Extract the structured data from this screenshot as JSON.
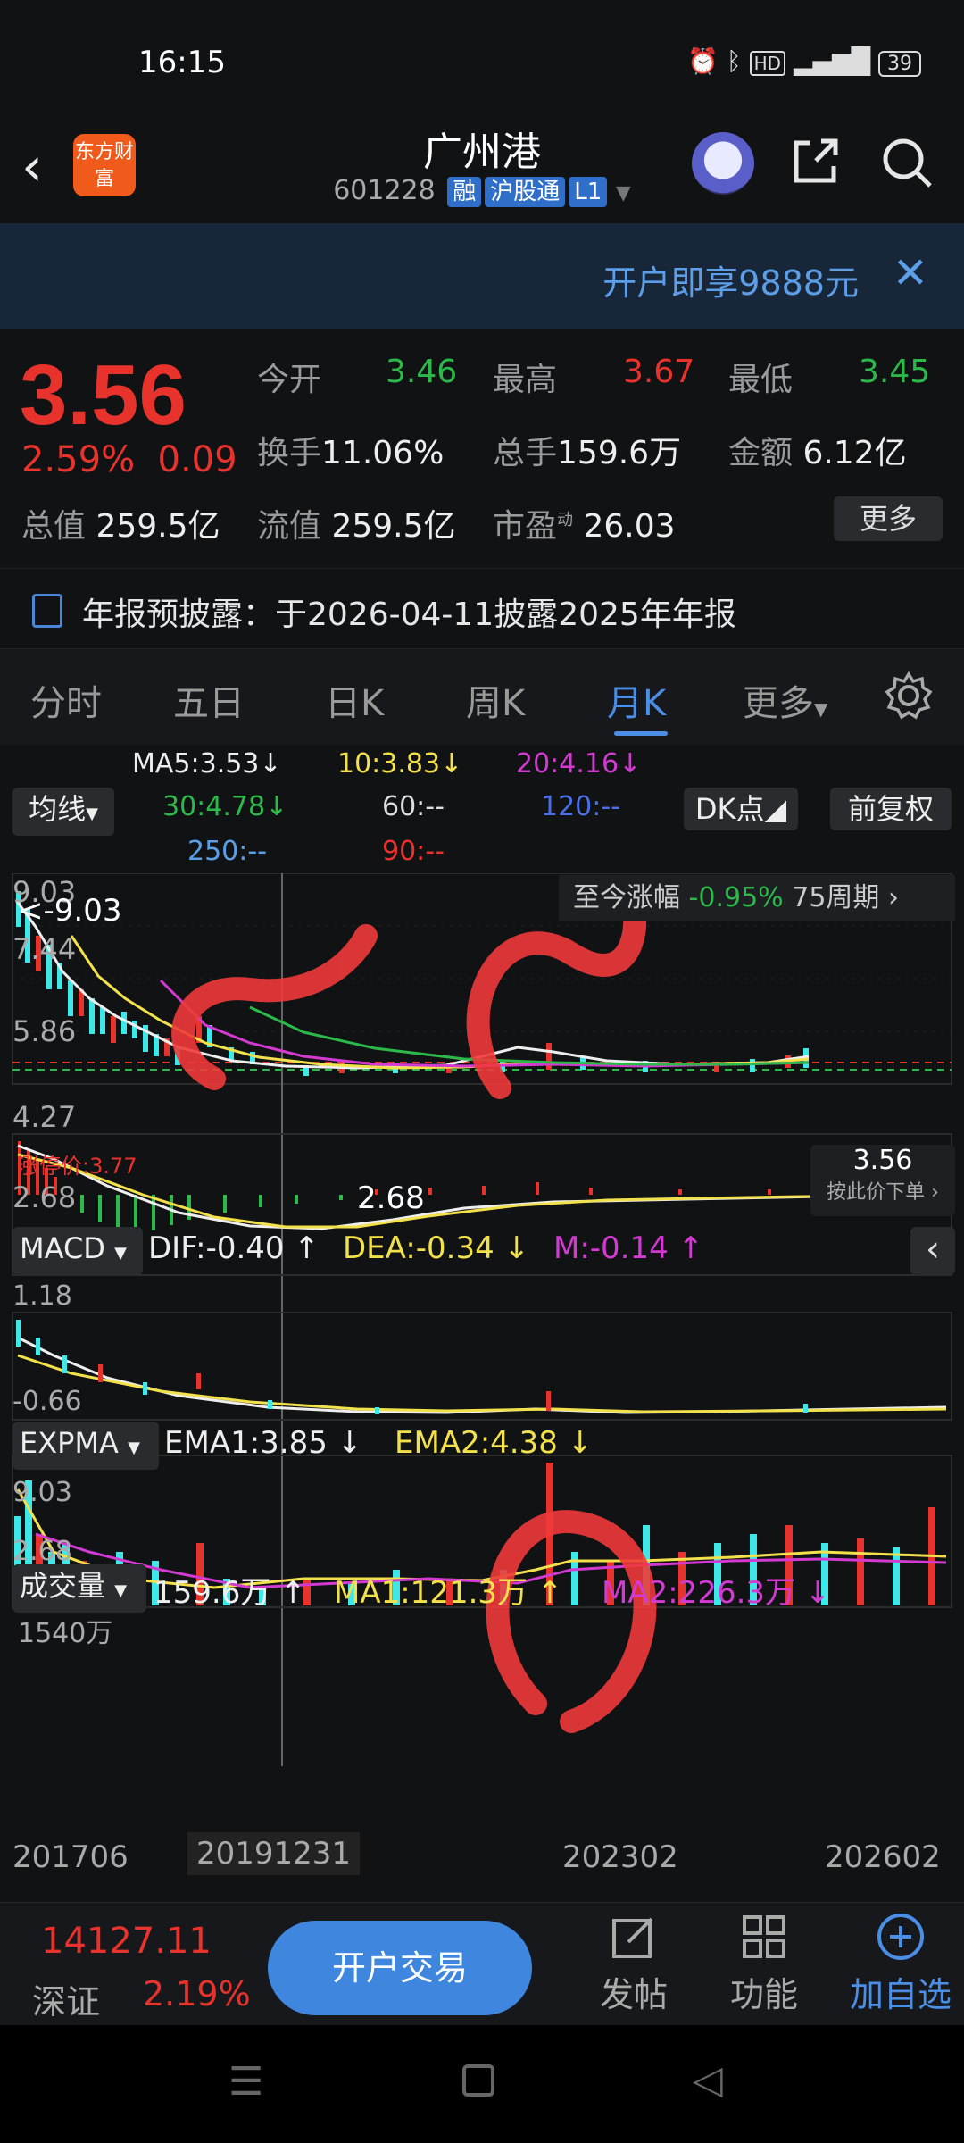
{
  "status_bar": {
    "time": "16:15",
    "battery": "39"
  },
  "header": {
    "logo_text": "东方财富",
    "stock_name": "广州港",
    "stock_code": "601228",
    "tags": [
      "融",
      "沪股通",
      "L1"
    ]
  },
  "banner": {
    "text": "开户即享9888元"
  },
  "quote": {
    "price": "3.56",
    "change_pct": "2.59%",
    "change": "0.09",
    "rows": [
      [
        {
          "label": "今开",
          "value": "3.46",
          "color": "green"
        },
        {
          "label": "最高",
          "value": "3.67",
          "color": "red"
        },
        {
          "label": "最低",
          "value": "3.45",
          "color": "green"
        }
      ],
      [
        {
          "label": "换手",
          "value": "11.06%",
          "color": "white"
        },
        {
          "label": "总手",
          "value": "159.6万",
          "color": "white"
        },
        {
          "label": "金额",
          "value": "6.12亿",
          "color": "white"
        }
      ]
    ],
    "row3": [
      {
        "label": "总值",
        "value": "259.5亿"
      },
      {
        "label": "流值",
        "value": "259.5亿"
      },
      {
        "label": "市盈",
        "value": "26.03",
        "sup": "动"
      }
    ],
    "more_label": "更多"
  },
  "notice": {
    "text": "年报预披露：于2026-04-11披露2025年年报"
  },
  "tabs": [
    {
      "label": "分时",
      "active": false
    },
    {
      "label": "五日",
      "active": false
    },
    {
      "label": "日K",
      "active": false
    },
    {
      "label": "周K",
      "active": false
    },
    {
      "label": "月K",
      "active": true
    },
    {
      "label": "更多",
      "active": false
    }
  ],
  "chart_controls": {
    "ma_type": "均线",
    "dk_label": "DK点",
    "adjust_label": "前复权",
    "ma_values": [
      "MA5:3.53",
      "10:3.83",
      "20:4.16",
      "30:4.78",
      "60:--",
      "120:--",
      "250:--",
      "90:--"
    ],
    "since_label": "至今涨幅",
    "since_pct": "-0.95%",
    "periods": "75周期",
    "watermark": "东方财富"
  },
  "main_chart": {
    "max_label": "9.03",
    "max_arrow": "<-9.03",
    "y_labels": [
      "7.44",
      "5.86",
      "4.27",
      "2.68"
    ],
    "limit_price": "涨停价:3.77",
    "min_label": "2.68",
    "price_tag": "3.56",
    "price_hint": "按此价下单"
  },
  "macd": {
    "name": "MACD",
    "dif": "DIF:-0.40",
    "dea": "DEA:-0.34",
    "m": "M:-0.14",
    "top": "1.18",
    "bottom": "-0.66"
  },
  "expma": {
    "name": "EXPMA",
    "ema1": "EMA1:3.85",
    "ema2": "EMA2:4.38",
    "top": "9.03",
    "bottom": "2.68"
  },
  "volume": {
    "name": "成交量",
    "value": "159.6万",
    "ma1": "MA1:121.3万",
    "ma2": "MA2:226.3万",
    "top": "1540万",
    "dates": [
      "201706",
      "20191231",
      "202302",
      "202602"
    ]
  },
  "bottom_bar": {
    "index_value": "14127.11",
    "index_name": "深证",
    "index_pct": "2.19%",
    "trade_label": "开户交易",
    "buttons": [
      "发帖",
      "功能",
      "加自选"
    ]
  },
  "colors": {
    "red": "#e8322c",
    "green": "#2db84a",
    "accent": "#4a8ee6",
    "yellow": "#f2e14a",
    "magenta": "#d23ad2"
  }
}
